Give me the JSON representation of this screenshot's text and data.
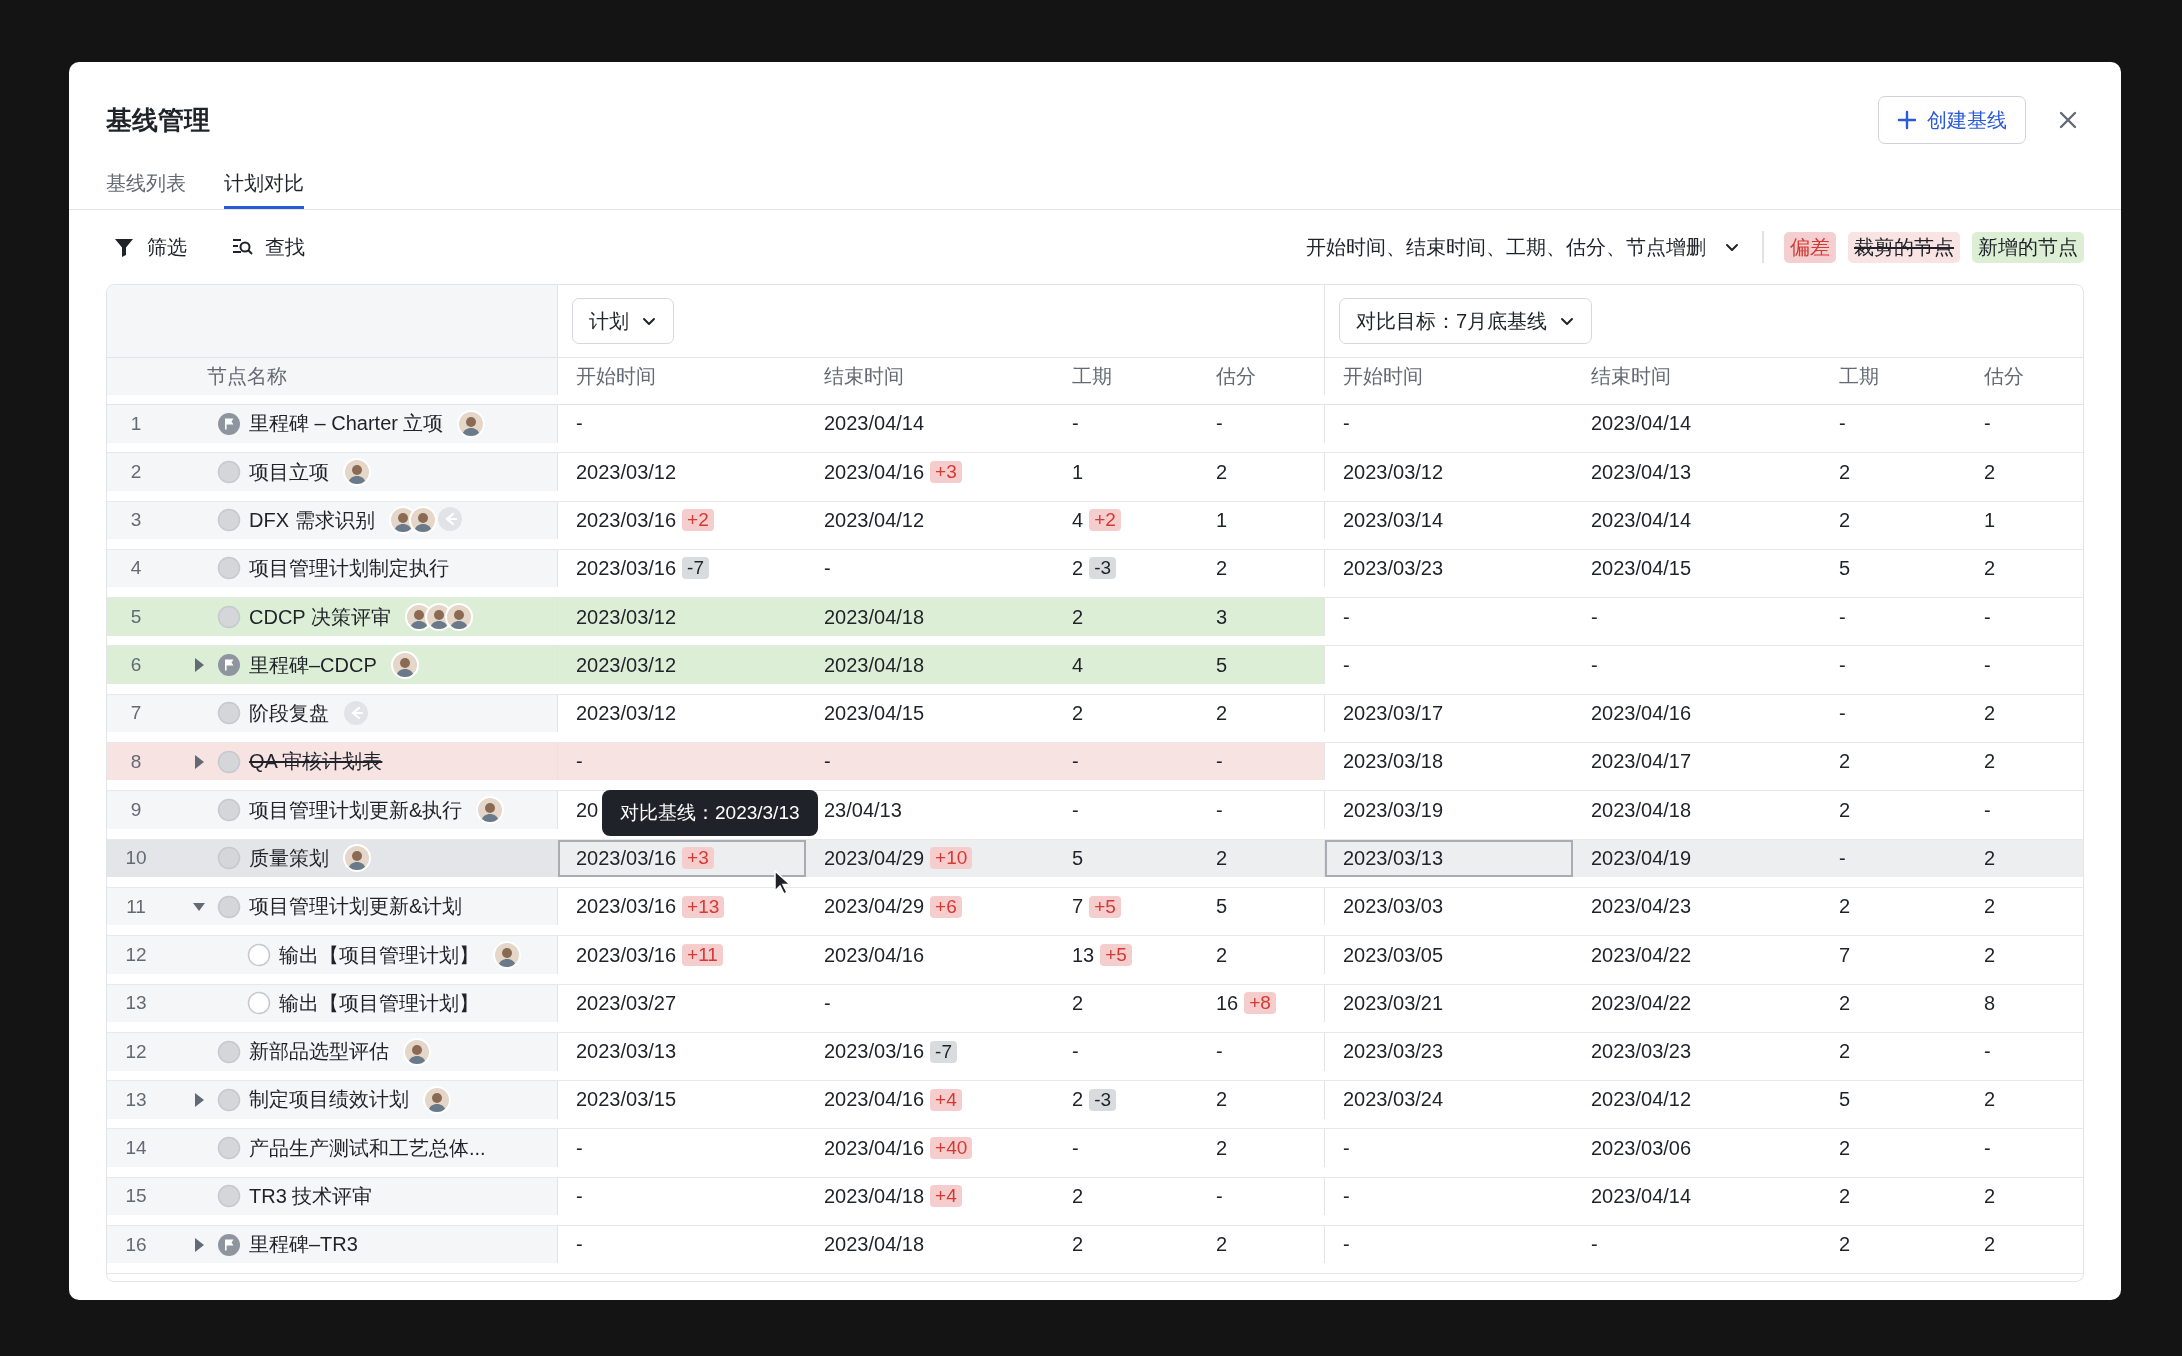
{
  "dialog": {
    "title": "基线管理",
    "create_button": "创建基线"
  },
  "tabs": [
    {
      "label": "基线列表",
      "selected": false
    },
    {
      "label": "计划对比",
      "selected": true
    }
  ],
  "toolbar": {
    "filter": "筛选",
    "find": "查找",
    "fields": "开始时间、结束时间、工期、估分、节点增删"
  },
  "legend": [
    {
      "kind": "deviation",
      "label": "偏差"
    },
    {
      "kind": "removed",
      "label": "裁剪的节点"
    },
    {
      "kind": "added",
      "label": "新增的节点"
    }
  ],
  "table": {
    "plan_select": "计划",
    "compare_select": "对比目标：7月底基线",
    "name_column": "节点名称",
    "columns": [
      "开始时间",
      "结束时间",
      "工期",
      "估分",
      "开始时间",
      "结束时间",
      "工期",
      "估分"
    ],
    "rows": [
      {
        "no": "1",
        "name": "里程碑 – Charter 立项",
        "kind": "milestone",
        "added": false,
        "removed": false,
        "selected": false,
        "assignees": [
          {
            "kind": "person"
          }
        ],
        "cells": [
          {
            "value": "-"
          },
          {
            "value": "2023/04/14"
          },
          {
            "value": "-"
          },
          {
            "value": "-"
          },
          {
            "value": "-"
          },
          {
            "value": "2023/04/14"
          },
          {
            "value": "-"
          },
          {
            "value": "-"
          }
        ]
      },
      {
        "no": "2",
        "name": "项目立项",
        "kind": "task",
        "added": false,
        "removed": false,
        "selected": false,
        "assignees": [
          {
            "kind": "person"
          }
        ],
        "cells": [
          {
            "value": "2023/03/12"
          },
          {
            "value": "2023/04/16",
            "delta": {
              "text": "+3",
              "kind": "up"
            }
          },
          {
            "value": "1"
          },
          {
            "value": "2"
          },
          {
            "value": "2023/03/12"
          },
          {
            "value": "2023/04/13"
          },
          {
            "value": "2"
          },
          {
            "value": "2"
          }
        ]
      },
      {
        "no": "3",
        "name": "DFX 需求识别",
        "kind": "task",
        "added": false,
        "removed": false,
        "selected": false,
        "assignees": [
          {
            "kind": "person"
          },
          {
            "kind": "person"
          },
          {
            "kind": "pending"
          }
        ],
        "cells": [
          {
            "value": "2023/03/16",
            "delta": {
              "text": "+2",
              "kind": "up"
            }
          },
          {
            "value": "2023/04/12"
          },
          {
            "value": "4",
            "delta": {
              "text": "+2",
              "kind": "up"
            }
          },
          {
            "value": "1"
          },
          {
            "value": "2023/03/14"
          },
          {
            "value": "2023/04/14"
          },
          {
            "value": "2"
          },
          {
            "value": "1"
          }
        ]
      },
      {
        "no": "4",
        "name": "项目管理计划制定执行",
        "kind": "task",
        "added": false,
        "removed": false,
        "selected": false,
        "cells": [
          {
            "value": "2023/03/16",
            "delta": {
              "text": "-7",
              "kind": "down"
            }
          },
          {
            "value": "-"
          },
          {
            "value": "2",
            "delta": {
              "text": "-3",
              "kind": "down"
            }
          },
          {
            "value": "2"
          },
          {
            "value": "2023/03/23"
          },
          {
            "value": "2023/04/15"
          },
          {
            "value": "5"
          },
          {
            "value": "2"
          }
        ]
      },
      {
        "no": "5",
        "name": "CDCP 决策评审",
        "kind": "task",
        "added": true,
        "removed": false,
        "selected": false,
        "assignees": [
          {
            "kind": "person"
          },
          {
            "kind": "person"
          },
          {
            "kind": "person"
          }
        ],
        "cells": [
          {
            "value": "2023/03/12"
          },
          {
            "value": "2023/04/18"
          },
          {
            "value": "2"
          },
          {
            "value": "3"
          },
          {
            "value": "-"
          },
          {
            "value": "-"
          },
          {
            "value": "-"
          },
          {
            "value": "-"
          }
        ]
      },
      {
        "no": "6",
        "name": "里程碑–CDCP",
        "kind": "milestone",
        "added": true,
        "removed": false,
        "selected": false,
        "expanded": false,
        "assignees": [
          {
            "kind": "person"
          }
        ],
        "cells": [
          {
            "value": "2023/03/12"
          },
          {
            "value": "2023/04/18"
          },
          {
            "value": "4"
          },
          {
            "value": "5"
          },
          {
            "value": "-"
          },
          {
            "value": "-"
          },
          {
            "value": "-"
          },
          {
            "value": "-"
          }
        ]
      },
      {
        "no": "7",
        "name": "阶段复盘",
        "kind": "task",
        "added": false,
        "removed": false,
        "selected": false,
        "assignees": [
          {
            "kind": "pending"
          }
        ],
        "cells": [
          {
            "value": "2023/03/12"
          },
          {
            "value": "2023/04/15"
          },
          {
            "value": "2"
          },
          {
            "value": "2"
          },
          {
            "value": "2023/03/17"
          },
          {
            "value": "2023/04/16"
          },
          {
            "value": "-"
          },
          {
            "value": "2"
          }
        ]
      },
      {
        "no": "8",
        "name": "QA 审核计划表",
        "kind": "task",
        "added": false,
        "removed": true,
        "selected": false,
        "expanded": false,
        "cells": [
          {
            "value": "-"
          },
          {
            "value": "-"
          },
          {
            "value": "-"
          },
          {
            "value": "-"
          },
          {
            "value": "2023/03/18"
          },
          {
            "value": "2023/04/17"
          },
          {
            "value": "2"
          },
          {
            "value": "2"
          }
        ]
      },
      {
        "no": "9",
        "name": "项目管理计划更新&执行",
        "kind": "task",
        "added": false,
        "removed": false,
        "selected": false,
        "assignees": [
          {
            "kind": "person"
          }
        ],
        "cells": [
          {
            "value": "20"
          },
          {
            "value": "23/04/13"
          },
          {
            "value": "-"
          },
          {
            "value": "-"
          },
          {
            "value": "2023/03/19"
          },
          {
            "value": "2023/04/18"
          },
          {
            "value": "2"
          },
          {
            "value": "-"
          }
        ]
      },
      {
        "no": "10",
        "name": "质量策划",
        "kind": "task",
        "added": false,
        "removed": false,
        "selected": true,
        "assignees": [
          {
            "kind": "person"
          }
        ],
        "cells": [
          {
            "value": "2023/03/16",
            "delta": {
              "text": "+3",
              "kind": "up"
            },
            "focused": true,
            "tooltip": "对比基线：2023/3/13"
          },
          {
            "value": "2023/04/29",
            "delta": {
              "text": "+10",
              "kind": "up"
            }
          },
          {
            "value": "5"
          },
          {
            "value": "2"
          },
          {
            "value": "2023/03/13",
            "focused": true
          },
          {
            "value": "2023/04/19"
          },
          {
            "value": "-"
          },
          {
            "value": "2"
          }
        ]
      },
      {
        "no": "11",
        "name": "项目管理计划更新&计划",
        "kind": "task",
        "added": false,
        "removed": false,
        "selected": false,
        "expanded": true,
        "cells": [
          {
            "value": "2023/03/16",
            "delta": {
              "text": "+13",
              "kind": "up"
            }
          },
          {
            "value": "2023/04/29",
            "delta": {
              "text": "+6",
              "kind": "up"
            }
          },
          {
            "value": "7",
            "delta": {
              "text": "+5",
              "kind": "up"
            }
          },
          {
            "value": "5"
          },
          {
            "value": "2023/03/03"
          },
          {
            "value": "2023/04/23"
          },
          {
            "value": "2"
          },
          {
            "value": "2"
          }
        ],
        "children": [
          {
            "no": "12",
            "name": "输出【项目管理计划】",
            "kind": "output",
            "added": false,
            "removed": false,
            "selected": false,
            "assignees": [
              {
                "kind": "person"
              }
            ],
            "cells": [
              {
                "value": "2023/03/16",
                "delta": {
                  "text": "+11",
                  "kind": "up"
                }
              },
              {
                "value": "2023/04/16"
              },
              {
                "value": "13",
                "delta": {
                  "text": "+5",
                  "kind": "up"
                }
              },
              {
                "value": "2"
              },
              {
                "value": "2023/03/05"
              },
              {
                "value": "2023/04/22"
              },
              {
                "value": "7"
              },
              {
                "value": "2"
              }
            ]
          },
          {
            "no": "13",
            "name": "输出【项目管理计划】",
            "kind": "output",
            "added": false,
            "removed": false,
            "selected": false,
            "cells": [
              {
                "value": "2023/03/27"
              },
              {
                "value": "-"
              },
              {
                "value": "2"
              },
              {
                "value": "16",
                "delta": {
                  "text": "+8",
                  "kind": "up"
                }
              },
              {
                "value": "2023/03/21"
              },
              {
                "value": "2023/04/22"
              },
              {
                "value": "2"
              },
              {
                "value": "8"
              }
            ]
          }
        ]
      },
      {
        "no": "12",
        "name": "新部品选型评估",
        "kind": "task",
        "added": false,
        "removed": false,
        "selected": false,
        "assignees": [
          {
            "kind": "person"
          }
        ],
        "cells": [
          {
            "value": "2023/03/13"
          },
          {
            "value": "2023/03/16",
            "delta": {
              "text": "-7",
              "kind": "down"
            }
          },
          {
            "value": "-"
          },
          {
            "value": "-"
          },
          {
            "value": "2023/03/23"
          },
          {
            "value": "2023/03/23"
          },
          {
            "value": "2"
          },
          {
            "value": "-"
          }
        ]
      },
      {
        "no": "13",
        "name": "制定项目绩效计划",
        "kind": "task",
        "added": false,
        "removed": false,
        "selected": false,
        "expanded": false,
        "assignees": [
          {
            "kind": "person"
          }
        ],
        "cells": [
          {
            "value": "2023/03/15"
          },
          {
            "value": "2023/04/16",
            "delta": {
              "text": "+4",
              "kind": "up"
            }
          },
          {
            "value": "2",
            "delta": {
              "text": "-3",
              "kind": "down"
            }
          },
          {
            "value": "2"
          },
          {
            "value": "2023/03/24"
          },
          {
            "value": "2023/04/12"
          },
          {
            "value": "5"
          },
          {
            "value": "2"
          }
        ]
      },
      {
        "no": "14",
        "name": "产品生产测试和工艺总体...",
        "kind": "task",
        "added": false,
        "removed": false,
        "selected": false,
        "cells": [
          {
            "value": "-"
          },
          {
            "value": "2023/04/16",
            "delta": {
              "text": "+40",
              "kind": "up"
            }
          },
          {
            "value": "-"
          },
          {
            "value": "2"
          },
          {
            "value": "-"
          },
          {
            "value": "2023/03/06"
          },
          {
            "value": "2"
          },
          {
            "value": "-"
          }
        ]
      },
      {
        "no": "15",
        "name": "TR3 技术评审",
        "kind": "task",
        "added": false,
        "removed": false,
        "selected": false,
        "cells": [
          {
            "value": "-"
          },
          {
            "value": "2023/04/18",
            "delta": {
              "text": "+4",
              "kind": "up"
            }
          },
          {
            "value": "2"
          },
          {
            "value": "-"
          },
          {
            "value": "-"
          },
          {
            "value": "2023/04/14"
          },
          {
            "value": "2"
          },
          {
            "value": "2"
          }
        ]
      },
      {
        "no": "16",
        "name": "里程碑–TR3",
        "kind": "milestone",
        "added": false,
        "removed": false,
        "selected": false,
        "expanded": false,
        "cells": [
          {
            "value": "-"
          },
          {
            "value": "2023/04/18"
          },
          {
            "value": "2"
          },
          {
            "value": "2"
          },
          {
            "value": "-"
          },
          {
            "value": "-"
          },
          {
            "value": "2"
          },
          {
            "value": "2"
          }
        ]
      }
    ]
  }
}
